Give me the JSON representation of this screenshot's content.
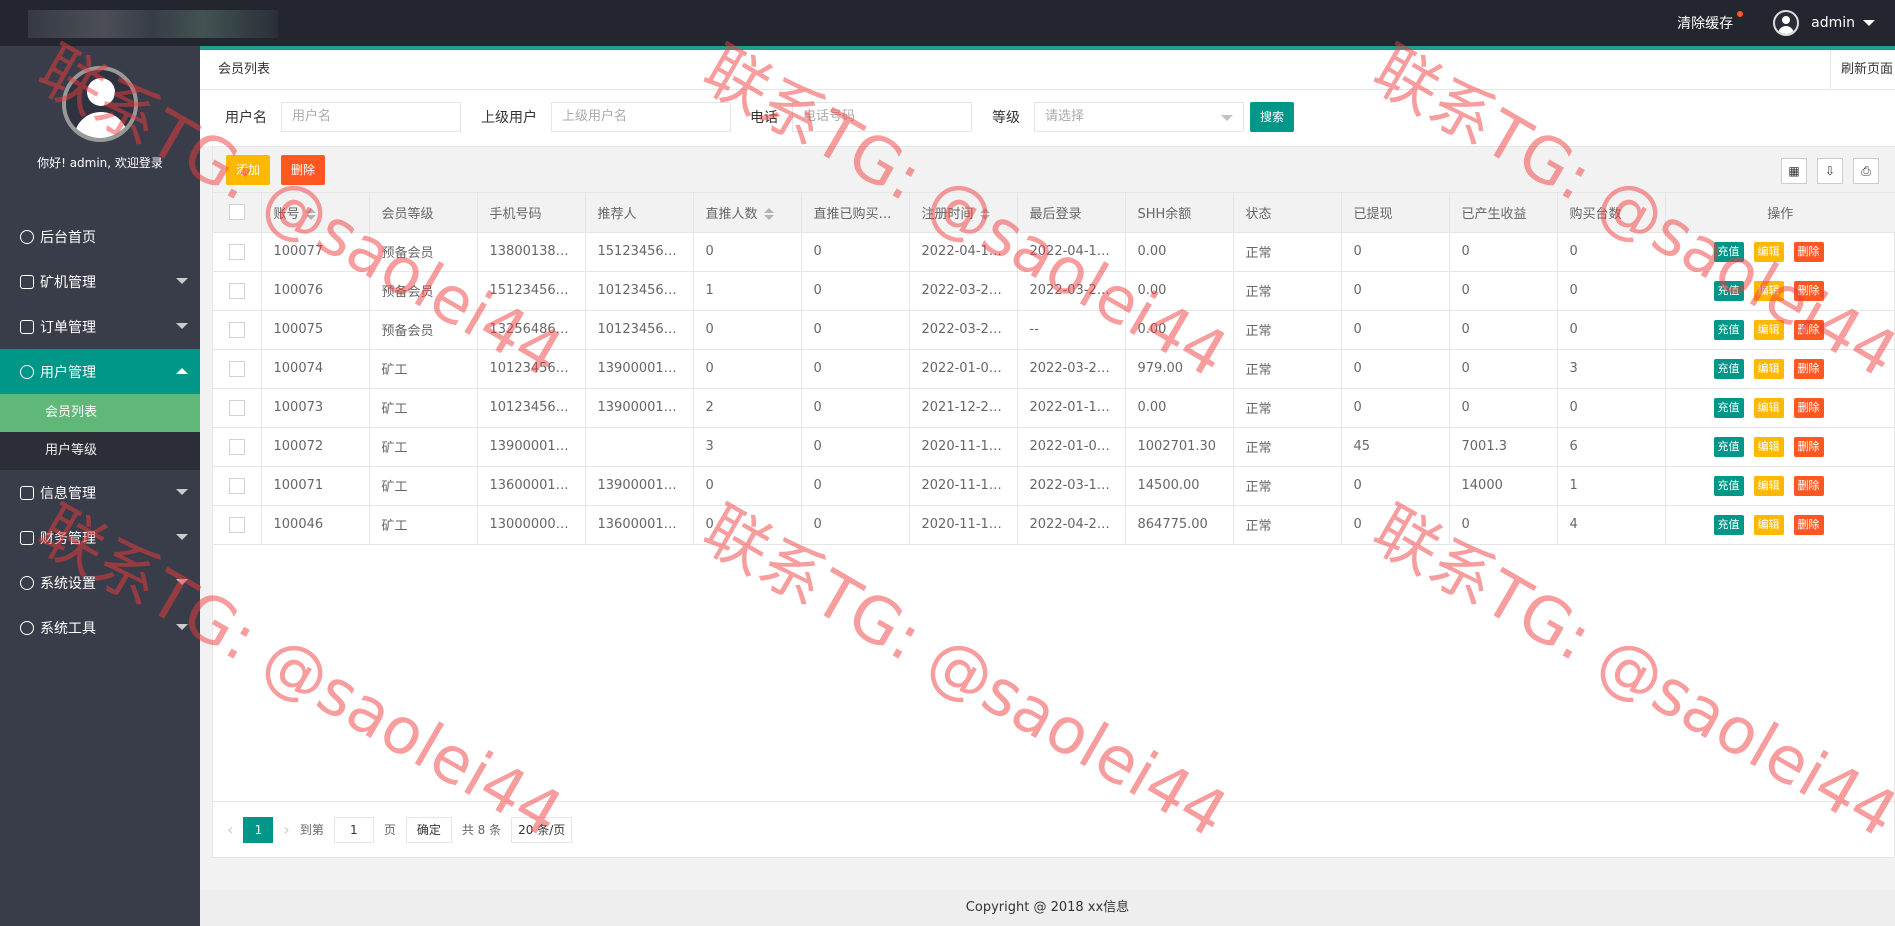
{
  "topbar": {
    "clear_cache": "清除缓存",
    "user": "admin"
  },
  "sidebar": {
    "welcome": "你好! admin, 欢迎登录",
    "items": [
      {
        "label": "后台首页",
        "icon": "dashboard-icon"
      },
      {
        "label": "矿机管理",
        "icon": "image-icon"
      },
      {
        "label": "订单管理",
        "icon": "list-icon"
      },
      {
        "label": "用户管理",
        "icon": "user-icon"
      },
      {
        "label": "信息管理",
        "icon": "doc-icon"
      },
      {
        "label": "财务管理",
        "icon": "finance-icon"
      },
      {
        "label": "系统设置",
        "icon": "gear-icon"
      },
      {
        "label": "系统工具",
        "icon": "tool-icon"
      }
    ],
    "sub": [
      "会员列表",
      "用户等级"
    ]
  },
  "tabs": {
    "current": "会员列表",
    "refresh": "刷新页面"
  },
  "search": {
    "username_label": "用户名",
    "username_placeholder": "用户名",
    "parent_label": "上级用户",
    "parent_placeholder": "上级用户名",
    "phone_label": "电话",
    "phone_placeholder": "电话号码",
    "level_label": "等级",
    "level_placeholder": "请选择",
    "button": "搜索"
  },
  "toolbar": {
    "add": "添加",
    "delete": "删除"
  },
  "table": {
    "headers": [
      "账号",
      "会员等级",
      "手机号码",
      "推荐人",
      "直推人数",
      "直推已购买…",
      "注册时间",
      "最后登录",
      "SHH余额",
      "状态",
      "已提现",
      "已产生收益",
      "购买台数",
      "操作"
    ],
    "rows": [
      [
        "100077",
        "预备会员",
        "13800138000",
        "15123456789",
        "0",
        "0",
        "2022-04-12…",
        "2022-04-12…",
        "0.00",
        "正常",
        "0",
        "0",
        "0"
      ],
      [
        "100076",
        "预备会员",
        "15123456789",
        "10123456789",
        "1",
        "0",
        "2022-03-25…",
        "2022-03-25…",
        "0.00",
        "正常",
        "0",
        "0",
        "0"
      ],
      [
        "100075",
        "预备会员",
        "13256486796",
        "10123456789",
        "0",
        "0",
        "2022-03-25…",
        "--",
        "0.00",
        "正常",
        "0",
        "0",
        "0"
      ],
      [
        "100074",
        "矿工",
        "10123456798",
        "13900001111",
        "0",
        "0",
        "2022-01-01…",
        "2022-03-25…",
        "979.00",
        "正常",
        "0",
        "0",
        "3"
      ],
      [
        "100073",
        "矿工",
        "10123456789",
        "13900001111",
        "2",
        "0",
        "2021-12-29…",
        "2022-01-10…",
        "0.00",
        "正常",
        "0",
        "0",
        "0"
      ],
      [
        "100072",
        "矿工",
        "13900001111",
        "",
        "3",
        "0",
        "2020-11-11 …",
        "2022-01-08…",
        "1002701.30",
        "正常",
        "45",
        "7001.3",
        "6"
      ],
      [
        "100071",
        "矿工",
        "13600001111",
        "13900001111",
        "0",
        "0",
        "2020-11-11 …",
        "2022-03-12…",
        "14500.00",
        "正常",
        "0",
        "14000",
        "1"
      ],
      [
        "100046",
        "矿工",
        "13000000000",
        "13600001111",
        "0",
        "0",
        "2020-11-11 …",
        "2022-04-21…",
        "864775.00",
        "正常",
        "0",
        "0",
        "4"
      ]
    ],
    "ops": {
      "recharge": "充值",
      "edit": "编辑",
      "delete": "删除"
    }
  },
  "pager": {
    "current": "1",
    "goto": "到第",
    "page_value": "1",
    "page_unit": "页",
    "ok": "确定",
    "total": "共 8 条",
    "size": "20 条/页"
  },
  "footer": "Copyright @ 2018 xx信息",
  "watermark": "联系TG: @saolei44"
}
